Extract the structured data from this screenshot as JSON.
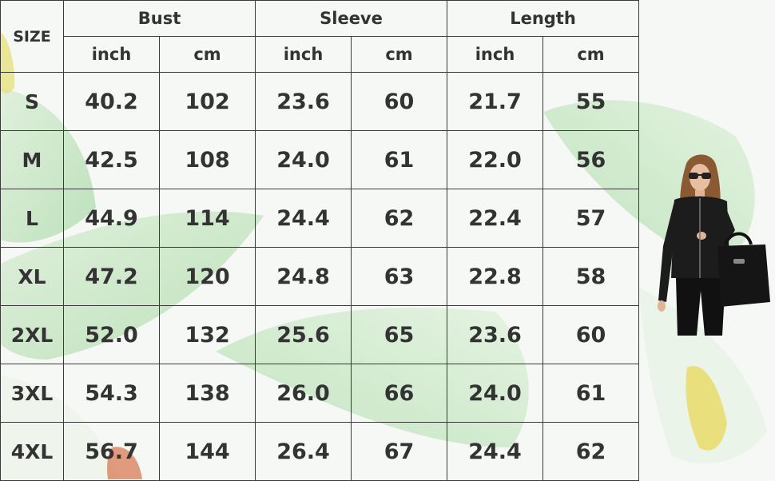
{
  "table": {
    "size_label": "SIZE",
    "groups": [
      "Bust",
      "Sleeve",
      "Length"
    ],
    "units": [
      "inch",
      "cm",
      "inch",
      "cm",
      "inch",
      "cm"
    ],
    "rows": [
      {
        "size": "S",
        "bust_in": "40.2",
        "bust_cm": "102",
        "sleeve_in": "23.6",
        "sleeve_cm": "60",
        "length_in": "21.7",
        "length_cm": "55"
      },
      {
        "size": "M",
        "bust_in": "42.5",
        "bust_cm": "108",
        "sleeve_in": "24.0",
        "sleeve_cm": "61",
        "length_in": "22.0",
        "length_cm": "56"
      },
      {
        "size": "L",
        "bust_in": "44.9",
        "bust_cm": "114",
        "sleeve_in": "24.4",
        "sleeve_cm": "62",
        "length_in": "22.4",
        "length_cm": "57"
      },
      {
        "size": "XL",
        "bust_in": "47.2",
        "bust_cm": "120",
        "sleeve_in": "24.8",
        "sleeve_cm": "63",
        "length_in": "22.8",
        "length_cm": "58"
      },
      {
        "size": "2XL",
        "bust_in": "52.0",
        "bust_cm": "132",
        "sleeve_in": "25.6",
        "sleeve_cm": "65",
        "length_in": "23.6",
        "length_cm": "60"
      },
      {
        "size": "3XL",
        "bust_in": "54.3",
        "bust_cm": "138",
        "sleeve_in": "26.0",
        "sleeve_cm": "66",
        "length_in": "24.0",
        "length_cm": "61"
      },
      {
        "size": "4XL",
        "bust_in": "56.7",
        "bust_cm": "144",
        "sleeve_in": "26.4",
        "sleeve_cm": "67",
        "length_in": "24.4",
        "length_cm": "62"
      }
    ]
  },
  "colors": {
    "text": "#333333",
    "border": "#3a3a3a",
    "leaf_green": "#a8d8a0",
    "jacket": "#1c1c1c"
  }
}
